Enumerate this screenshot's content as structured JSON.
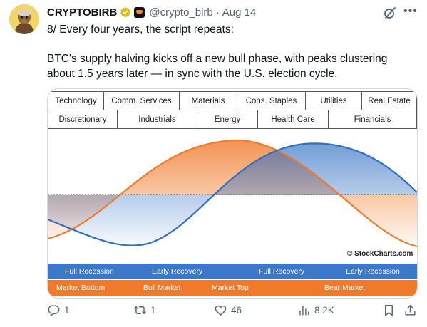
{
  "tweet": {
    "author_name": "CRYPTOBIRB",
    "handle": "@crypto_birb",
    "separator": "·",
    "date": "Aug 14",
    "line1": "8/ Every four years, the script repeats:",
    "line2": "BTC's supply halving kicks off a new bull phase, with peaks clustering",
    "line3": "about 1.5 years later — in sync with the U.S. election cycle."
  },
  "image": {
    "sectors_row1": [
      "Technology",
      "Comm. Services",
      "Materials",
      "Cons. Staples",
      "Utilities",
      "Real Estate"
    ],
    "sectors_row2": [
      "Discretionary",
      "Industrials",
      "Energy",
      "Health Care",
      "Financials"
    ],
    "credit": "© StockCharts.com",
    "economy_phases": [
      "Full Recession",
      "Early Recovery",
      "Full Recovery",
      "Early Recession"
    ],
    "market_phases": [
      "Market Bottom",
      "Bull Market",
      "Market Top",
      "Bear Market"
    ],
    "colors": {
      "economy_band": "#3a78c9",
      "market_band": "#f07a2a",
      "economy_curve": "#2f6fc4",
      "market_curve": "#f07a2a"
    }
  },
  "actions": {
    "replies": "1",
    "reposts": "1",
    "likes": "46",
    "views": "8.2K"
  },
  "icons": [
    "verified-badge-icon",
    "org-badge-icon",
    "grok-icon",
    "more-icon",
    "reply-icon",
    "repost-icon",
    "like-icon",
    "views-icon",
    "bookmark-icon",
    "share-icon"
  ]
}
